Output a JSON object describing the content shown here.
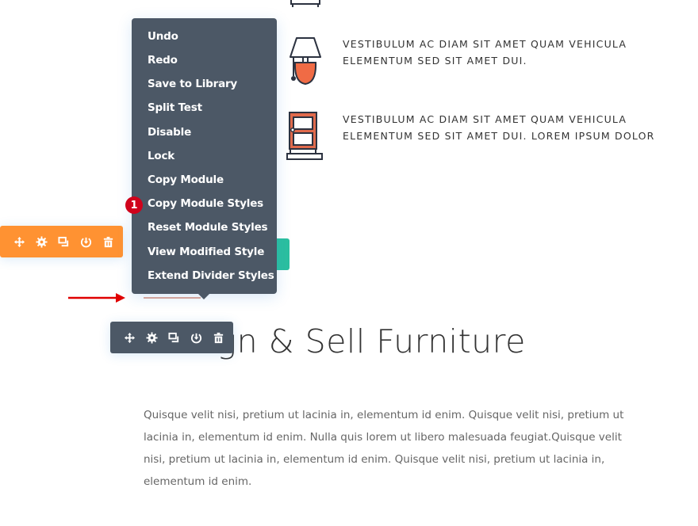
{
  "blurbs": [
    {
      "icon": "bed-icon",
      "text": ""
    },
    {
      "icon": "lamp-icon",
      "text_line1": "VESTIBULUM AC DIAM SIT AMET QUAM VEHICULA",
      "text_line2": "ELEMENTUM SED SIT AMET DUI."
    },
    {
      "icon": "door-icon",
      "text_line1": "VESTIBULUM AC DIAM SIT AMET QUAM VEHICULA",
      "text_line2": "ELEMENTUM SED SIT AMET DUI. LOREM IPSUM DOLOR"
    }
  ],
  "heading": "Design & Sell Furniture",
  "paragraph": "Quisque velit nisi, pretium ut lacinia in, elementum id enim. Quisque velit nisi, pretium ut lacinia in, elementum id enim. Nulla quis lorem ut libero malesuada feugiat.Quisque velit nisi, pretium ut lacinia in, elementum id enim. Quisque velit nisi, pretium ut lacinia in, elementum id enim.",
  "context_menu": {
    "items": [
      {
        "label": "Undo"
      },
      {
        "label": "Redo"
      },
      {
        "label": "Save to Library"
      },
      {
        "label": "Split Test"
      },
      {
        "label": "Disable"
      },
      {
        "label": "Lock"
      },
      {
        "label": "Copy Module"
      },
      {
        "label": "Copy Module Styles"
      },
      {
        "label": "Reset Module Styles"
      },
      {
        "label": "View Modified Style"
      },
      {
        "label": "Extend Divider Styles"
      }
    ]
  },
  "step_badge": "1",
  "toolbars": {
    "row_toolbar": {
      "color": "#ff9232",
      "buttons": [
        "move-icon",
        "settings-icon",
        "duplicate-icon",
        "save-icon",
        "delete-icon"
      ]
    },
    "module_toolbar": {
      "color": "#4c5866",
      "buttons": [
        "move-icon",
        "settings-icon",
        "duplicate-icon",
        "save-icon",
        "delete-icon"
      ]
    }
  },
  "colors": {
    "menu_bg": "#4c5866",
    "badge": "#d0021b",
    "accent_orange": "#ff9232",
    "accent_teal": "#2bbf9f",
    "arrow": "#e00000",
    "lamp_base": "#f06b45",
    "door": "#e06a4c"
  }
}
